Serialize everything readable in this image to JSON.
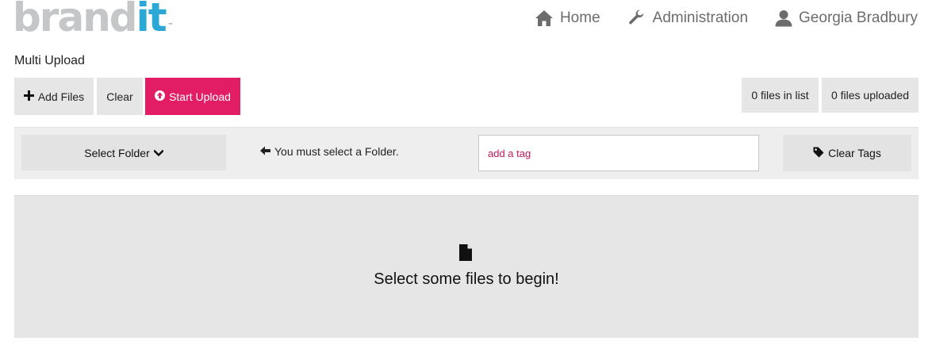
{
  "header": {
    "logo": {
      "brand": "brand",
      "it": "it",
      "tm": "™"
    },
    "nav": {
      "home": {
        "label": "Home",
        "icon": "home-icon"
      },
      "admin": {
        "label": "Administration",
        "icon": "wrench-icon"
      },
      "user": {
        "label": "Georgia Bradbury",
        "icon": "user-icon"
      }
    }
  },
  "page": {
    "title": "Multi Upload"
  },
  "toolbar": {
    "add_files": {
      "label": "Add Files",
      "icon": "plus-icon"
    },
    "clear": {
      "label": "Clear"
    },
    "start_upload": {
      "label": "Start Upload",
      "icon": "upload-circle-icon"
    },
    "files_in_list": "0 files in list",
    "files_uploaded": "0 files uploaded"
  },
  "filters": {
    "select_folder": {
      "label": "Select Folder",
      "icon": "chevron-down-icon"
    },
    "folder_hint": {
      "text": "You must select a Folder.",
      "icon": "arrow-left-icon"
    },
    "tag_input": {
      "placeholder": "add a tag",
      "value": ""
    },
    "clear_tags": {
      "label": "Clear Tags",
      "icon": "tag-icon"
    }
  },
  "dropzone": {
    "message": "Select some files to begin!",
    "icon": "file-icon"
  },
  "colors": {
    "accent": "#e21d65",
    "logo_grey": "#c4c6c8",
    "logo_blue": "#2ba8d6",
    "button_grey": "#e6e6e6",
    "nav_text": "#6c6c6c",
    "tag_placeholder": "#c2185b"
  }
}
